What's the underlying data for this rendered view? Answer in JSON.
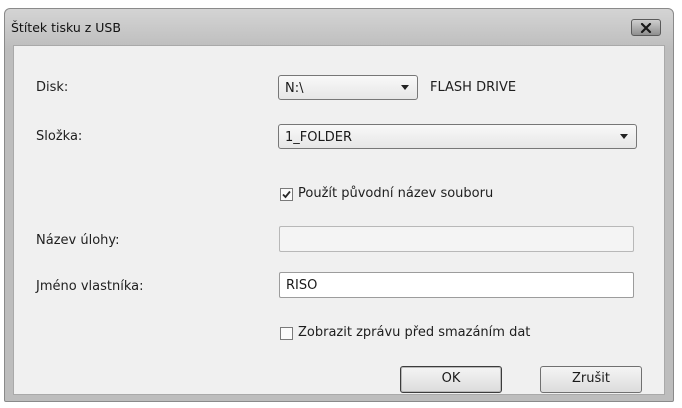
{
  "window": {
    "title": "Štítek tisku z USB"
  },
  "form": {
    "disk_label": "Disk:",
    "disk_value": "N:\\",
    "disk_name": "FLASH DRIVE",
    "folder_label": "Složka:",
    "folder_value": "1_FOLDER",
    "use_original_name_label": "Použít původní název souboru",
    "use_original_name_checked": true,
    "job_name_label": "Název úlohy:",
    "job_name_value": "",
    "owner_label": "Jméno vlastníka:",
    "owner_value": "RISO",
    "show_message_label": "Zobrazit zprávu před smazáním dat",
    "show_message_checked": false
  },
  "buttons": {
    "ok": "OK",
    "cancel": "Zrušit"
  }
}
